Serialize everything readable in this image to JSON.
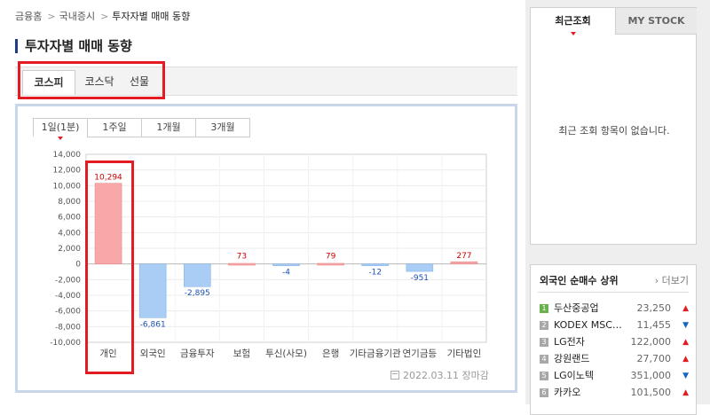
{
  "breadcrumb": {
    "items": [
      "금융홈",
      "국내증시",
      "투자자별 매매 동향"
    ]
  },
  "page_title": "투자자별 매매 동향",
  "market_tabs": [
    {
      "label": "코스피",
      "active": true
    },
    {
      "label": "코스닥",
      "active": false
    },
    {
      "label": "선물",
      "active": false
    }
  ],
  "period_tabs": [
    {
      "label": "1일(1분)",
      "active": true
    },
    {
      "label": "1주일",
      "active": false
    },
    {
      "label": "1개월",
      "active": false
    },
    {
      "label": "3개월",
      "active": false
    }
  ],
  "chart_data": {
    "type": "bar",
    "categories": [
      "개인",
      "외국인",
      "금융투자",
      "보험",
      "투신(사모)",
      "은행",
      "기타금융기관",
      "연기금등",
      "기타법인"
    ],
    "values": [
      10294,
      -6861,
      -2895,
      73,
      -4,
      79,
      -12,
      -951,
      277
    ],
    "value_labels": [
      "10,294",
      "-6,861",
      "-2,895",
      "73",
      "-4",
      "79",
      "-12",
      "-951",
      "277"
    ],
    "yticks": [
      "14,000",
      "12,000",
      "10,000",
      "8,000",
      "6,000",
      "4,000",
      "2,000",
      "0",
      "-2,000",
      "-4,000",
      "-6,000",
      "-8,000",
      "-10,000"
    ],
    "ylim": [
      -10000,
      14000
    ],
    "grid": true,
    "positive_color": "#f8a8a8",
    "negative_color": "#a9cdf5",
    "positive_label_color": "#cc0000",
    "negative_label_color": "#1a4fb4"
  },
  "chart_footer": {
    "date": "2022.03.11 장마감"
  },
  "recent": {
    "tabs": [
      "최근조회",
      "MY STOCK"
    ],
    "empty_message": "최근 조회 항목이 없습니다."
  },
  "foreign": {
    "title": "외국인 순매수 상위",
    "more_label": "더보기",
    "items": [
      {
        "rank": "1",
        "name": "두산중공업",
        "price": "23,250",
        "dir": "up"
      },
      {
        "rank": "2",
        "name": "KODEX MSC…",
        "price": "11,455",
        "dir": "down"
      },
      {
        "rank": "3",
        "name": "LG전자",
        "price": "122,000",
        "dir": "up"
      },
      {
        "rank": "4",
        "name": "강원랜드",
        "price": "27,700",
        "dir": "up"
      },
      {
        "rank": "5",
        "name": "LG이노텍",
        "price": "351,000",
        "dir": "down"
      },
      {
        "rank": "6",
        "name": "카카오",
        "price": "101,500",
        "dir": "up"
      }
    ]
  },
  "colors": {
    "highlight": "#e31b23",
    "title_bar": "#1d3d8a"
  }
}
